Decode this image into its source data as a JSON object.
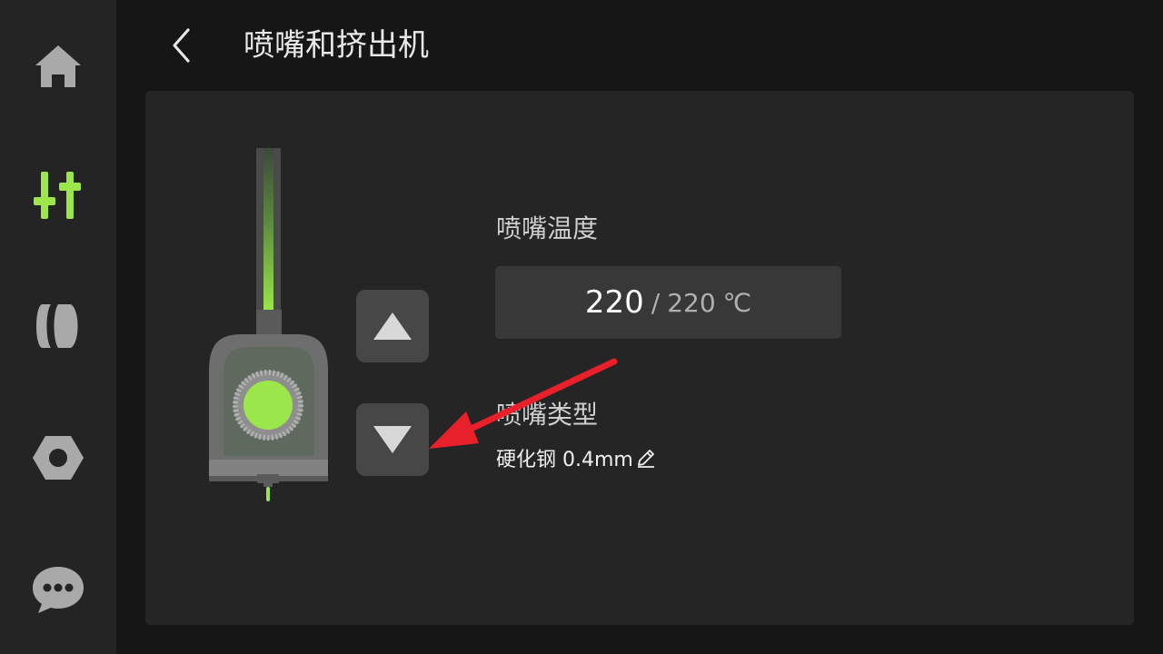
{
  "header": {
    "back_icon": "chevron-left-icon",
    "title": "喷嘴和挤出机"
  },
  "sidebar": {
    "items": [
      {
        "icon": "home-icon",
        "active": false
      },
      {
        "icon": "sliders-icon",
        "active": true
      },
      {
        "icon": "filament-icon",
        "active": false
      },
      {
        "icon": "settings-nut-icon",
        "active": false
      },
      {
        "icon": "chat-bubble-icon",
        "active": false
      }
    ]
  },
  "extruder": {
    "up_button_icon": "triangle-up-icon",
    "down_button_icon": "triangle-down-icon"
  },
  "nozzle_temperature": {
    "label": "喷嘴温度",
    "current": "220",
    "separator": "/",
    "target": "220",
    "unit": "℃"
  },
  "nozzle_type": {
    "label": "喷嘴类型",
    "value": "硬化钢 0.4mm",
    "edit_icon": "pencil-icon"
  },
  "colors": {
    "accent": "#9be64a",
    "icon_inactive": "#a9a9a9",
    "sidebar_bg": "#242424",
    "panel_bg": "#252525",
    "annotation_arrow": "#e8202a"
  }
}
